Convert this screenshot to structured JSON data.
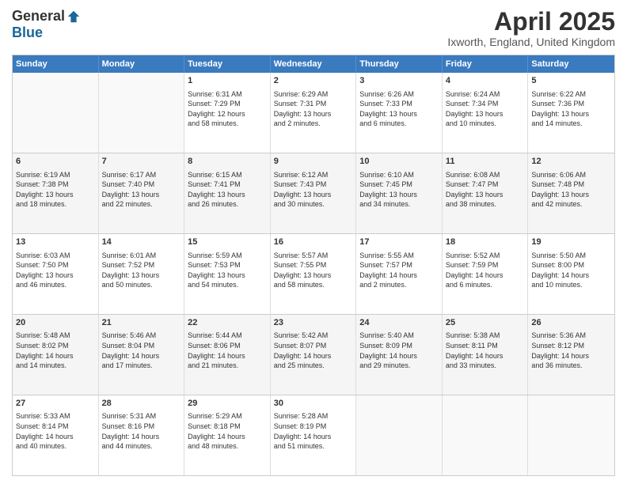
{
  "logo": {
    "general": "General",
    "blue": "Blue"
  },
  "title": "April 2025",
  "subtitle": "Ixworth, England, United Kingdom",
  "days": [
    "Sunday",
    "Monday",
    "Tuesday",
    "Wednesday",
    "Thursday",
    "Friday",
    "Saturday"
  ],
  "rows": [
    [
      {
        "num": "",
        "lines": []
      },
      {
        "num": "",
        "lines": []
      },
      {
        "num": "1",
        "lines": [
          "Sunrise: 6:31 AM",
          "Sunset: 7:29 PM",
          "Daylight: 12 hours",
          "and 58 minutes."
        ]
      },
      {
        "num": "2",
        "lines": [
          "Sunrise: 6:29 AM",
          "Sunset: 7:31 PM",
          "Daylight: 13 hours",
          "and 2 minutes."
        ]
      },
      {
        "num": "3",
        "lines": [
          "Sunrise: 6:26 AM",
          "Sunset: 7:33 PM",
          "Daylight: 13 hours",
          "and 6 minutes."
        ]
      },
      {
        "num": "4",
        "lines": [
          "Sunrise: 6:24 AM",
          "Sunset: 7:34 PM",
          "Daylight: 13 hours",
          "and 10 minutes."
        ]
      },
      {
        "num": "5",
        "lines": [
          "Sunrise: 6:22 AM",
          "Sunset: 7:36 PM",
          "Daylight: 13 hours",
          "and 14 minutes."
        ]
      }
    ],
    [
      {
        "num": "6",
        "lines": [
          "Sunrise: 6:19 AM",
          "Sunset: 7:38 PM",
          "Daylight: 13 hours",
          "and 18 minutes."
        ]
      },
      {
        "num": "7",
        "lines": [
          "Sunrise: 6:17 AM",
          "Sunset: 7:40 PM",
          "Daylight: 13 hours",
          "and 22 minutes."
        ]
      },
      {
        "num": "8",
        "lines": [
          "Sunrise: 6:15 AM",
          "Sunset: 7:41 PM",
          "Daylight: 13 hours",
          "and 26 minutes."
        ]
      },
      {
        "num": "9",
        "lines": [
          "Sunrise: 6:12 AM",
          "Sunset: 7:43 PM",
          "Daylight: 13 hours",
          "and 30 minutes."
        ]
      },
      {
        "num": "10",
        "lines": [
          "Sunrise: 6:10 AM",
          "Sunset: 7:45 PM",
          "Daylight: 13 hours",
          "and 34 minutes."
        ]
      },
      {
        "num": "11",
        "lines": [
          "Sunrise: 6:08 AM",
          "Sunset: 7:47 PM",
          "Daylight: 13 hours",
          "and 38 minutes."
        ]
      },
      {
        "num": "12",
        "lines": [
          "Sunrise: 6:06 AM",
          "Sunset: 7:48 PM",
          "Daylight: 13 hours",
          "and 42 minutes."
        ]
      }
    ],
    [
      {
        "num": "13",
        "lines": [
          "Sunrise: 6:03 AM",
          "Sunset: 7:50 PM",
          "Daylight: 13 hours",
          "and 46 minutes."
        ]
      },
      {
        "num": "14",
        "lines": [
          "Sunrise: 6:01 AM",
          "Sunset: 7:52 PM",
          "Daylight: 13 hours",
          "and 50 minutes."
        ]
      },
      {
        "num": "15",
        "lines": [
          "Sunrise: 5:59 AM",
          "Sunset: 7:53 PM",
          "Daylight: 13 hours",
          "and 54 minutes."
        ]
      },
      {
        "num": "16",
        "lines": [
          "Sunrise: 5:57 AM",
          "Sunset: 7:55 PM",
          "Daylight: 13 hours",
          "and 58 minutes."
        ]
      },
      {
        "num": "17",
        "lines": [
          "Sunrise: 5:55 AM",
          "Sunset: 7:57 PM",
          "Daylight: 14 hours",
          "and 2 minutes."
        ]
      },
      {
        "num": "18",
        "lines": [
          "Sunrise: 5:52 AM",
          "Sunset: 7:59 PM",
          "Daylight: 14 hours",
          "and 6 minutes."
        ]
      },
      {
        "num": "19",
        "lines": [
          "Sunrise: 5:50 AM",
          "Sunset: 8:00 PM",
          "Daylight: 14 hours",
          "and 10 minutes."
        ]
      }
    ],
    [
      {
        "num": "20",
        "lines": [
          "Sunrise: 5:48 AM",
          "Sunset: 8:02 PM",
          "Daylight: 14 hours",
          "and 14 minutes."
        ]
      },
      {
        "num": "21",
        "lines": [
          "Sunrise: 5:46 AM",
          "Sunset: 8:04 PM",
          "Daylight: 14 hours",
          "and 17 minutes."
        ]
      },
      {
        "num": "22",
        "lines": [
          "Sunrise: 5:44 AM",
          "Sunset: 8:06 PM",
          "Daylight: 14 hours",
          "and 21 minutes."
        ]
      },
      {
        "num": "23",
        "lines": [
          "Sunrise: 5:42 AM",
          "Sunset: 8:07 PM",
          "Daylight: 14 hours",
          "and 25 minutes."
        ]
      },
      {
        "num": "24",
        "lines": [
          "Sunrise: 5:40 AM",
          "Sunset: 8:09 PM",
          "Daylight: 14 hours",
          "and 29 minutes."
        ]
      },
      {
        "num": "25",
        "lines": [
          "Sunrise: 5:38 AM",
          "Sunset: 8:11 PM",
          "Daylight: 14 hours",
          "and 33 minutes."
        ]
      },
      {
        "num": "26",
        "lines": [
          "Sunrise: 5:36 AM",
          "Sunset: 8:12 PM",
          "Daylight: 14 hours",
          "and 36 minutes."
        ]
      }
    ],
    [
      {
        "num": "27",
        "lines": [
          "Sunrise: 5:33 AM",
          "Sunset: 8:14 PM",
          "Daylight: 14 hours",
          "and 40 minutes."
        ]
      },
      {
        "num": "28",
        "lines": [
          "Sunrise: 5:31 AM",
          "Sunset: 8:16 PM",
          "Daylight: 14 hours",
          "and 44 minutes."
        ]
      },
      {
        "num": "29",
        "lines": [
          "Sunrise: 5:29 AM",
          "Sunset: 8:18 PM",
          "Daylight: 14 hours",
          "and 48 minutes."
        ]
      },
      {
        "num": "30",
        "lines": [
          "Sunrise: 5:28 AM",
          "Sunset: 8:19 PM",
          "Daylight: 14 hours",
          "and 51 minutes."
        ]
      },
      {
        "num": "",
        "lines": []
      },
      {
        "num": "",
        "lines": []
      },
      {
        "num": "",
        "lines": []
      }
    ]
  ]
}
